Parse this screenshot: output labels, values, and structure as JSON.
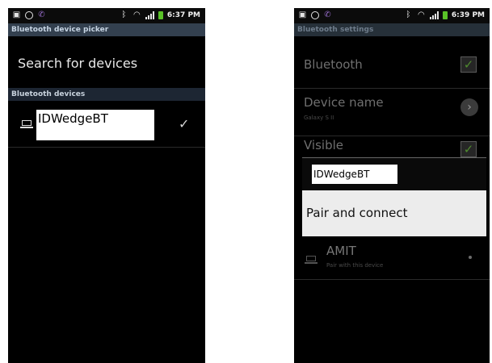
{
  "left_screen": {
    "status_bar": {
      "time": "6:37 PM"
    },
    "title": "Bluetooth device picker",
    "search_label": "Search for devices",
    "section_header": "Bluetooth devices",
    "device": {
      "name": "IDWedgeBT",
      "icon": "laptop-icon",
      "check": "✓"
    }
  },
  "right_screen": {
    "status_bar": {
      "time": "6:39 PM"
    },
    "title": "Bluetooth settings",
    "bluetooth_label": "Bluetooth",
    "device_name_label": "Device name",
    "device_name_value": "Galaxy S II",
    "visible_label": "Visible",
    "dialog": {
      "device_name": "IDWedgeBT",
      "option": "Pair and connect"
    },
    "paired_device": {
      "name": "AMIT",
      "subtitle": "Pair with this device",
      "icon": "laptop-icon"
    }
  },
  "colors": {
    "title_bar": "#33404f",
    "section_header": "#1d2633",
    "battery": "#59c227"
  }
}
